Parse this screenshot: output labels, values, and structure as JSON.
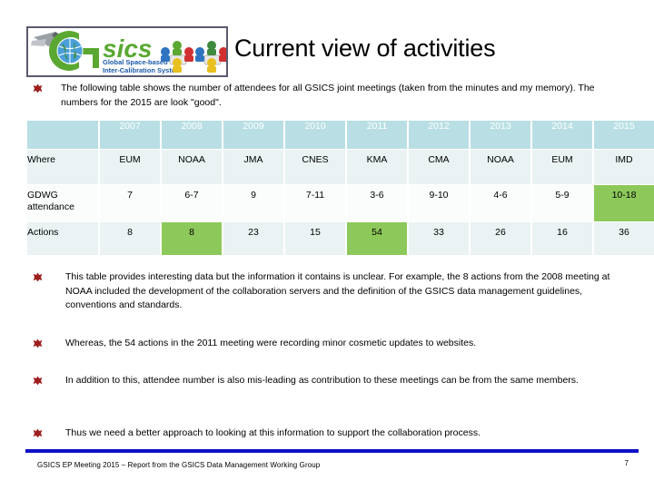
{
  "slide": {
    "title": "Current view of activities",
    "logo": {
      "name": "gsics-logo",
      "wordmark": "sics",
      "tagline_line1": "Global Space-based",
      "tagline_line2": "Inter-Calibration System"
    }
  },
  "bullets": {
    "intro": "The following table shows the number of attendees for all GSICS joint meetings (taken from the minutes and my memory).  The numbers for the 2015 are look \"good\".",
    "b1": "This table provides interesting data but the information it contains is unclear.  For example, the 8 actions from the 2008 meeting at NOAA included the development of the collaboration servers and the definition of the GSICS data management guidelines, conventions and standards.",
    "b2": "Whereas, the 54 actions in the 2011 meeting were recording minor cosmetic updates to websites.",
    "b3": "In addition to this, attendee number is also mis-leading as contribution to these meetings can be from the same members.",
    "b4": "Thus we need a better approach to looking at this information to support the collaboration process."
  },
  "table": {
    "corner_label": "",
    "years": [
      "2007",
      "2008",
      "2009",
      "2010",
      "2011",
      "2012",
      "2013",
      "2014",
      "2015"
    ],
    "rows": [
      {
        "label": "Where",
        "values": [
          "EUM",
          "NOAA",
          "JMA",
          "CNES",
          "KMA",
          "CMA",
          "NOAA",
          "EUM",
          "IMD"
        ],
        "highlight": [
          false,
          false,
          false,
          false,
          false,
          false,
          false,
          false,
          false
        ]
      },
      {
        "label": "GDWG attendance",
        "values": [
          "7",
          "6-7",
          "9",
          "7-11",
          "3-6",
          "9-10",
          "4-6",
          "5-9",
          "10-18"
        ],
        "highlight": [
          false,
          false,
          false,
          false,
          false,
          false,
          false,
          false,
          true
        ]
      },
      {
        "label": "Actions",
        "values": [
          "8",
          "8",
          "23",
          "15",
          "54",
          "33",
          "26",
          "16",
          "36"
        ],
        "highlight": [
          false,
          true,
          false,
          false,
          true,
          false,
          false,
          false,
          false
        ]
      }
    ]
  },
  "footer": {
    "text": "GSICS EP Meeting 2015 – Report from the GSICS Data Management Working Group",
    "page": "7"
  },
  "colors": {
    "header_bg": "#b9dfe4",
    "cell_bg": "#eaf2f3",
    "alt_cell_bg": "#fbfdfd",
    "highlight_green": "#8dc95a",
    "footer_rule": "#1010c8",
    "bullet_red": "#9e2020"
  }
}
